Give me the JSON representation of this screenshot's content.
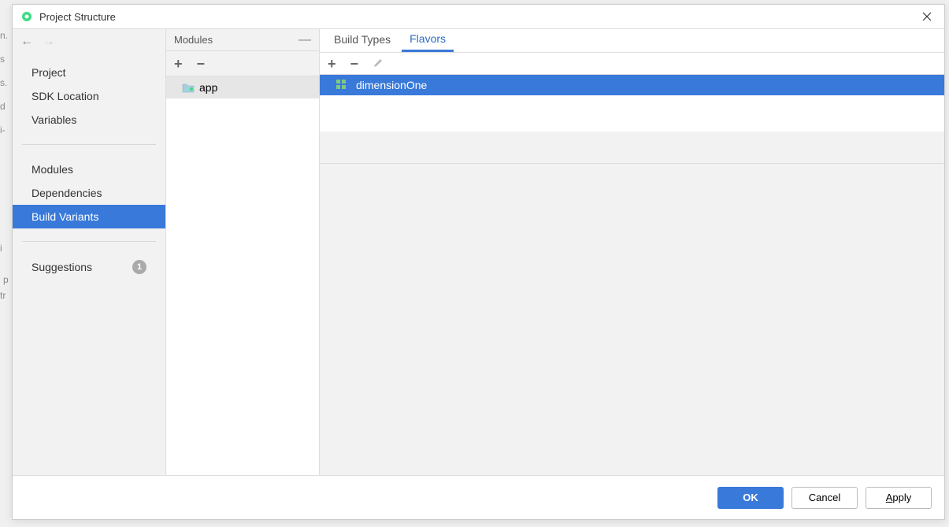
{
  "window": {
    "title": "Project Structure"
  },
  "sidebar": {
    "items": [
      {
        "label": "Project"
      },
      {
        "label": "SDK Location"
      },
      {
        "label": "Variables"
      },
      {
        "label": "Modules"
      },
      {
        "label": "Dependencies"
      },
      {
        "label": "Build Variants"
      },
      {
        "label": "Suggestions"
      }
    ],
    "suggestions_badge": "1"
  },
  "modules_panel": {
    "header": "Modules",
    "items": [
      {
        "label": "app"
      }
    ]
  },
  "content": {
    "tabs": [
      {
        "label": "Build Types"
      },
      {
        "label": "Flavors"
      }
    ],
    "flavors": [
      {
        "label": "dimensionOne"
      }
    ]
  },
  "footer": {
    "ok": "OK",
    "cancel": "Cancel",
    "apply_prefix": "A",
    "apply_rest": "pply"
  }
}
